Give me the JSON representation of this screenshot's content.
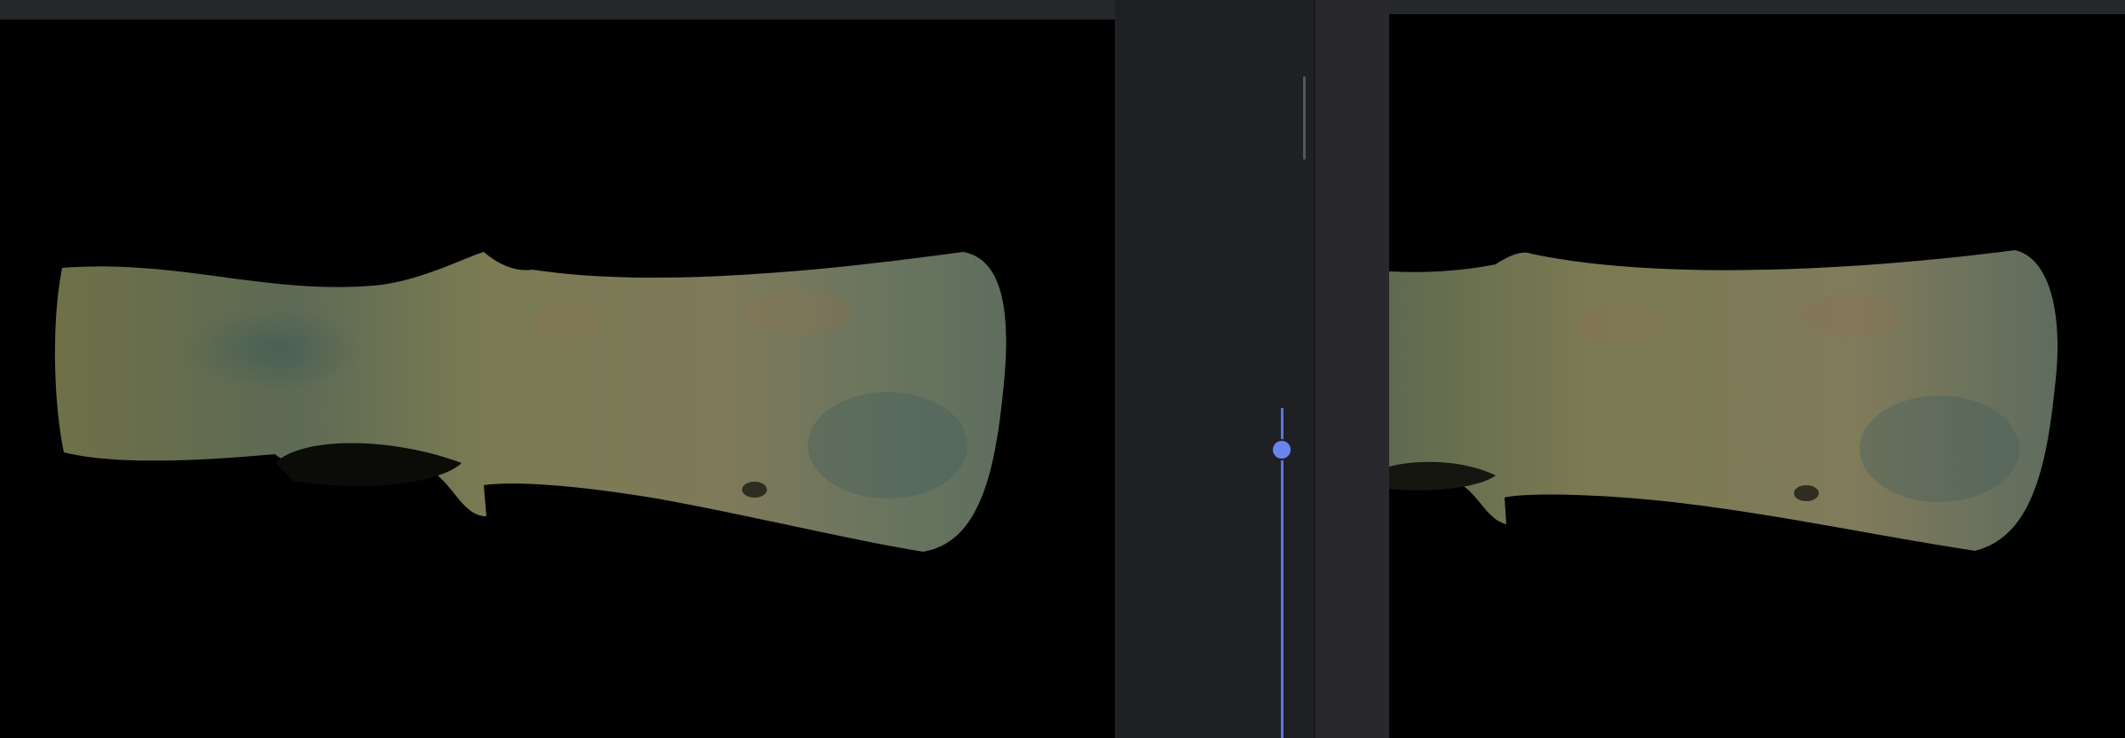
{
  "viewer": {
    "left_image": {
      "icon": "axe-artifact-photo",
      "background": "#000000"
    },
    "right_image": {
      "icon": "axe-artifact-photo-zoomed",
      "background": "#000000"
    },
    "slider": {
      "accent": "#6a84ef",
      "value": 0.08
    },
    "scrollbar": {
      "position": 0.1
    }
  }
}
